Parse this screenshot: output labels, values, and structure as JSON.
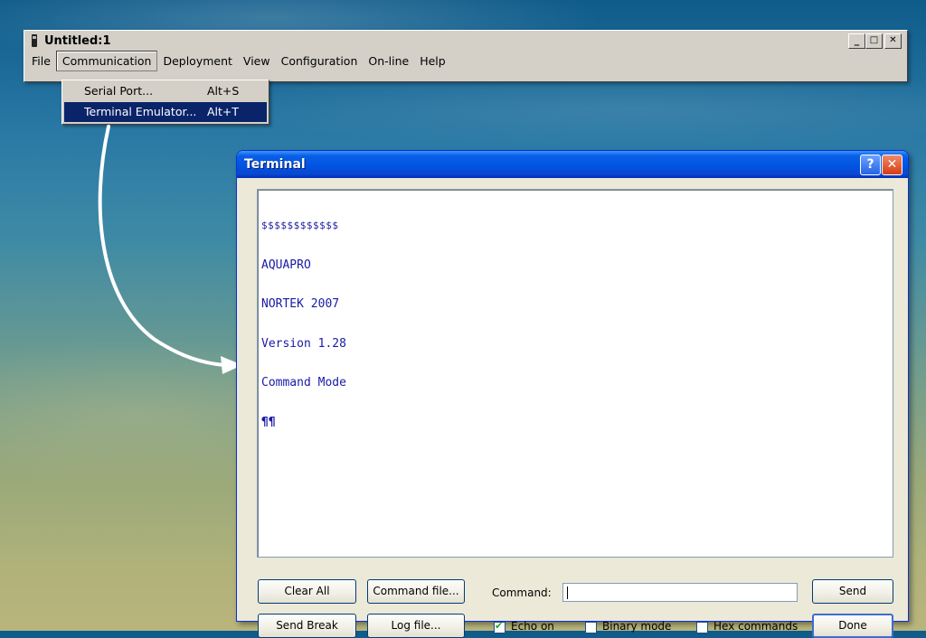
{
  "app": {
    "title": "Untitled:1",
    "controls": {
      "minimize": "_",
      "maximize": "□",
      "close": "✕"
    },
    "menu": [
      "File",
      "Communication",
      "Deployment",
      "View",
      "Configuration",
      "On-line",
      "Help"
    ]
  },
  "dropdown": {
    "items": [
      {
        "label": "Serial Port...",
        "accel": "Alt+S"
      },
      {
        "label": "Terminal Emulator...",
        "accel": "Alt+T"
      }
    ]
  },
  "terminal": {
    "title": "Terminal",
    "help_icon": "?",
    "close_icon": "✕",
    "lines": [
      "$$$$$$$$$$$$",
      "AQUAPRO",
      "NORTEK 2007",
      "Version 1.28",
      "Command Mode",
      "¶¶"
    ],
    "buttons": {
      "clear_all": "Clear All",
      "command_file": "Command file...",
      "send": "Send",
      "send_break": "Send Break",
      "log_file": "Log file...",
      "done": "Done"
    },
    "command_label": "Command:",
    "command_value": "",
    "echo_on": {
      "label": "Echo on",
      "checked": true
    },
    "binary_mode": {
      "label": "Binary mode",
      "checked": false
    },
    "hex_commands": {
      "label": "Hex commands",
      "checked": false
    }
  }
}
